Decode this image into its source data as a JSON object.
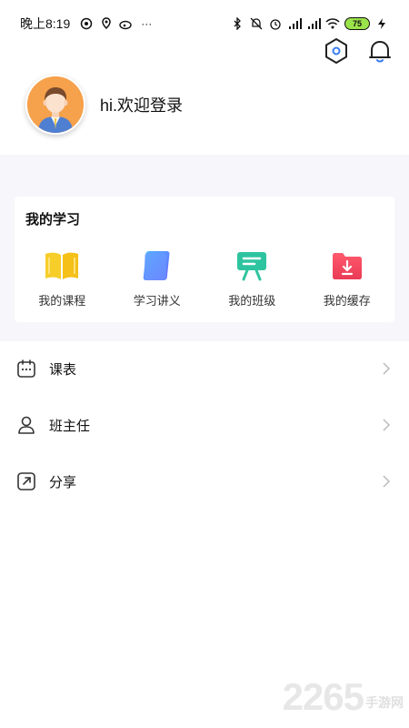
{
  "status_bar": {
    "time": "晚上8:19",
    "battery": "75",
    "more": "···"
  },
  "header": {
    "greeting": "hi.欢迎登录"
  },
  "study": {
    "title": "我的学习",
    "items": [
      {
        "label": "我的课程",
        "icon": "book-icon",
        "color": "#f5c518"
      },
      {
        "label": "学习讲义",
        "icon": "handout-icon",
        "color": "#5b8cff"
      },
      {
        "label": "我的班级",
        "icon": "class-board-icon",
        "color": "#2ec4a0"
      },
      {
        "label": "我的缓存",
        "icon": "download-folder-icon",
        "color": "#f0455e"
      }
    ]
  },
  "menu": [
    {
      "label": "课表",
      "icon": "calendar-icon"
    },
    {
      "label": "班主任",
      "icon": "teacher-icon"
    },
    {
      "label": "分享",
      "icon": "share-icon"
    }
  ],
  "watermark": {
    "number": "2265",
    "text": "手游网"
  }
}
